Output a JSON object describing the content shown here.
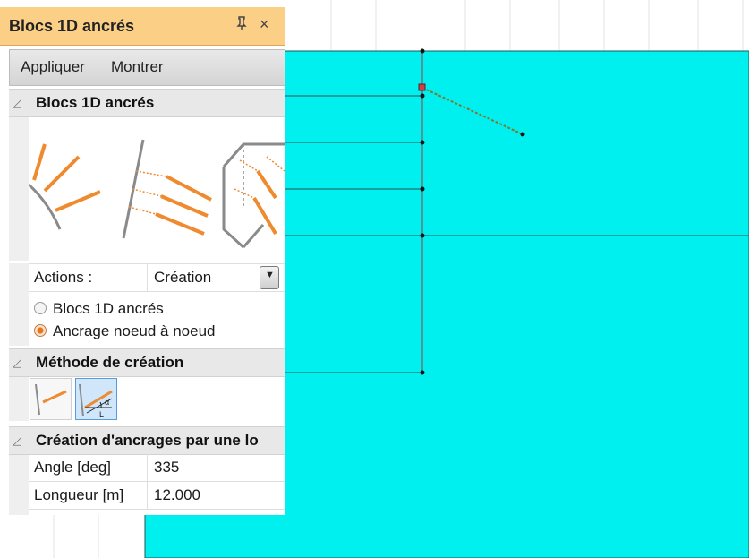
{
  "panel": {
    "title": "Blocs 1D ancrés",
    "pin_glyph": "1",
    "close_glyph": "×",
    "toolbar": {
      "apply": "Appliquer",
      "show": "Montrer"
    }
  },
  "sections": {
    "anchored_blocks": "Blocs 1D ancrés",
    "creation_method": "Méthode de création",
    "creation_by_length": "Création d'ancrages par une lo"
  },
  "properties": {
    "actions_label": "Actions :",
    "actions_value": "Création",
    "radio_option_1": "Blocs 1D ancrés",
    "radio_option_2": "Ancrage noeud à noeud",
    "selected_option": "Ancrage noeud à noeud",
    "angle_label": "Angle [deg]",
    "angle_value": "335",
    "length_label": "Longueur [m]",
    "length_value": "12.000"
  },
  "method_buttons": [
    {
      "name": "node-to-node",
      "selected": false
    },
    {
      "name": "angle-length",
      "selected": true,
      "glyph_alpha": "α",
      "glyph_L": "L"
    }
  ],
  "colors": {
    "soil": "#00f0f0",
    "title_bar": "#fbcf86",
    "anchor": "#e87722",
    "selection": "#cfe6fb"
  }
}
